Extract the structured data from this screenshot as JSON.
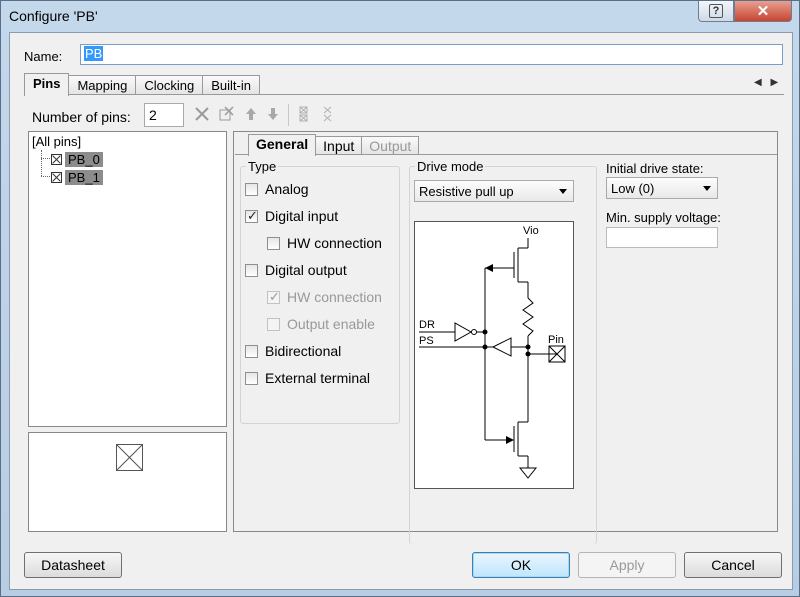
{
  "window": {
    "title": "Configure 'PB'",
    "help_label": "?",
    "close_label": "✕"
  },
  "name": {
    "label": "Name:",
    "value": "PB"
  },
  "tabs": [
    "Pins",
    "Mapping",
    "Clocking",
    "Built-in"
  ],
  "tab_arrows": "◀ ▶",
  "pins": {
    "count_label": "Number of pins:",
    "count_value": "2"
  },
  "tree": {
    "root": "[All pins]",
    "items": [
      "PB_0",
      "PB_1"
    ]
  },
  "subtabs": [
    "General",
    "Input",
    "Output"
  ],
  "type_group": {
    "title": "Type",
    "analog": "Analog",
    "digital_input": "Digital input",
    "hw_connection_in": "HW connection",
    "digital_output": "Digital output",
    "hw_connection_out": "HW connection",
    "output_enable": "Output enable",
    "bidirectional": "Bidirectional",
    "external_terminal": "External terminal"
  },
  "drive_mode": {
    "title": "Drive mode",
    "value": "Resistive pull up"
  },
  "schematic_labels": {
    "vio": "Vio",
    "dr": "DR",
    "ps": "PS",
    "pin": "Pin"
  },
  "initial_drive": {
    "label": "Initial drive state:",
    "value": "Low (0)"
  },
  "min_supply": {
    "label": "Min. supply voltage:",
    "value": ""
  },
  "buttons": {
    "datasheet": "Datasheet",
    "ok": "OK",
    "apply": "Apply",
    "cancel": "Cancel"
  }
}
